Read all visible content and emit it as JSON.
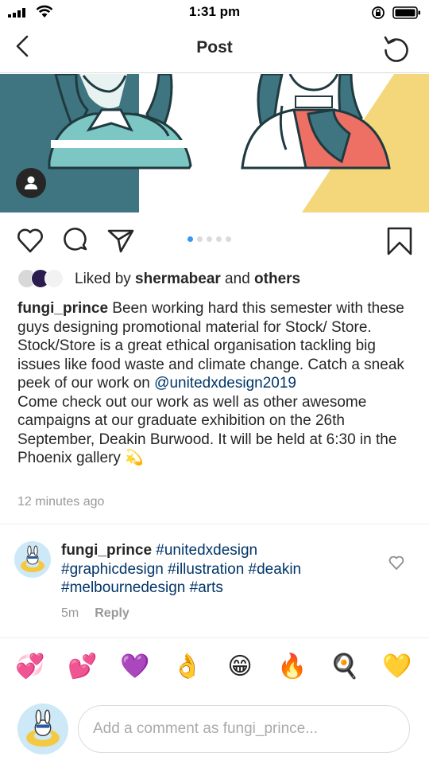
{
  "status_bar": {
    "time": "1:31 pm"
  },
  "header": {
    "title": "Post",
    "back_icon": "chevron-left-icon",
    "refresh_icon": "refresh-icon"
  },
  "post": {
    "carousel": {
      "total": 5,
      "active_index": 0
    },
    "likes": {
      "prefix": "Liked by ",
      "user": "shermabear",
      "middle": " and ",
      "others": "others"
    },
    "caption": {
      "username": "fungi_prince",
      "line1": " Been working hard this semester with these guys designing promotional material for Stock/ Store.",
      "para2_text": "Stock/Store is a great ethical organisation tackling big issues like food waste and climate change. Catch a sneak peek of our work on ",
      "para2_mention": "@unitedxdesign2019",
      "para3_text": "Come check out our work as well as other awesome campaigns at our graduate exhibition on the 26th September, Deakin Burwood. It will be held at 6:30 in the Phoenix gallery ",
      "para3_emoji": "💫"
    },
    "timestamp": "12 minutes ago"
  },
  "comment": {
    "username": "fungi_prince",
    "tag1": "#unitedxdesign",
    "tag2": "#graphicdesign",
    "tag3": "#illustration",
    "tag4": "#deakin",
    "tag5": "#melbournedesign",
    "tag6": "#arts",
    "time": "5m",
    "reply_label": "Reply"
  },
  "emoji_bar": [
    "💞",
    "💕",
    "💜",
    "👌",
    "😁",
    "🔥",
    "🍳",
    "💛"
  ],
  "comment_input": {
    "placeholder": "Add a comment as fungi_prince..."
  },
  "colors": {
    "link": "#003569",
    "muted": "#999999",
    "accent": "#3897f0",
    "teal": "#3f7580"
  }
}
